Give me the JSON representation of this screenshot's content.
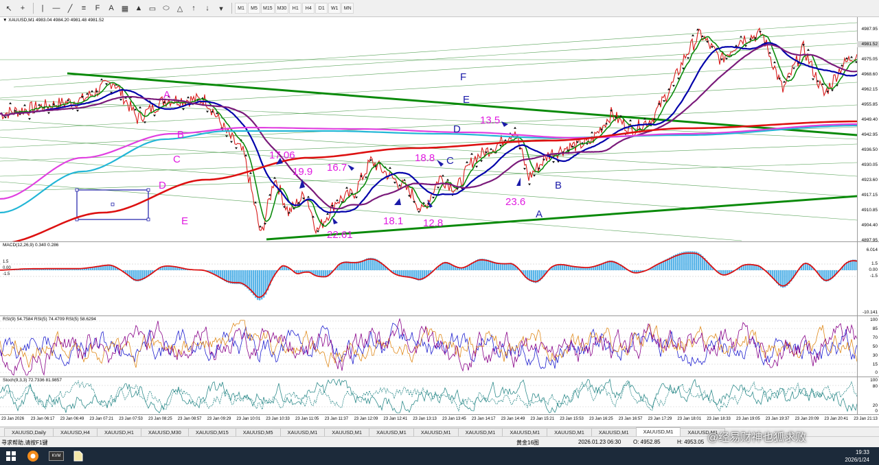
{
  "toolbar": {
    "timeframes": [
      "M1",
      "M5",
      "M15",
      "M30",
      "H1",
      "H4",
      "D1",
      "W1",
      "MN"
    ]
  },
  "main_pane": {
    "title": "XAUUSD,M1  4983.04 4984.20 4981.48 4981.52",
    "price_tag": "4981.52",
    "price_labels": [
      "4987.95",
      "4981.52",
      "4975.05",
      "4968.60",
      "4962.15",
      "4955.85",
      "4949.40",
      "4942.95",
      "4936.50",
      "4930.05",
      "4923.60",
      "4917.15",
      "4910.85",
      "4904.40",
      "4897.95"
    ],
    "wave_labels_magenta": [
      "A",
      "B",
      "C",
      "D",
      "E"
    ],
    "wave_labels_blue": [
      "F",
      "E",
      "D",
      "C",
      "B",
      "A"
    ],
    "number_labels": [
      "17.06",
      "19.9",
      "16.7",
      "18.8",
      "13.5",
      "22.61",
      "18.1",
      "12.8",
      "23.6"
    ]
  },
  "macd_pane": {
    "title": "MACD(12,26,9) 0.340 0.286",
    "axis_labels": [
      "6.014",
      "1.5",
      "0.00",
      "-1.5",
      "-10.141"
    ],
    "left_labels": [
      "1.5",
      "0.00",
      "-1.5"
    ]
  },
  "rsi_pane": {
    "title": "RSI(9) 54.7584  RSI(5) 74.4709  RSI(5) 58.6294",
    "axis_labels": [
      "100",
      "85",
      "70",
      "50",
      "30",
      "15",
      "0"
    ]
  },
  "stoch_pane": {
    "title": "Stoch(9,3,3) 72.7336 81.9857",
    "axis_labels": [
      "100",
      "80",
      "20",
      "0"
    ]
  },
  "time_axis": [
    "23 Jan 2026",
    "23 Jan 06:17",
    "23 Jan 06:49",
    "23 Jan 07:21",
    "23 Jan 07:53",
    "23 Jan 08:25",
    "23 Jan 08:57",
    "23 Jan 09:29",
    "23 Jan 10:01",
    "23 Jan 10:33",
    "23 Jan 11:05",
    "23 Jan 11:37",
    "23 Jan 12:09",
    "23 Jan 12:41",
    "23 Jan 13:13",
    "23 Jan 13:45",
    "23 Jan 14:17",
    "23 Jan 14:49",
    "23 Jan 15:21",
    "23 Jan 15:53",
    "23 Jan 16:25",
    "23 Jan 16:57",
    "23 Jan 17:29",
    "23 Jan 18:01",
    "23 Jan 18:33",
    "23 Jan 19:05",
    "23 Jan 19:37",
    "23 Jan 20:09",
    "23 Jan 20:41",
    "23 Jan 21:13"
  ],
  "tabs": [
    "XAUUSD,Daily",
    "XAUUSD,H4",
    "XAUUSD,H1",
    "XAUUSD,M30",
    "XAUUSD,M15",
    "XAUUSD,M5",
    "XAUUSD,M1",
    "XAUUSD,M1",
    "XAUUSD,M1",
    "XAUUSD,M1",
    "XAUUSD,M1",
    "XAUUSD,M1",
    "XAUUSD,M1",
    "XAUUSD,M1",
    "XAUUSD,M1",
    "XAUUSD,M1"
  ],
  "active_tab_index": 14,
  "statusbar": {
    "help": "寻求帮助,请按F1键",
    "profile": "黄金16图",
    "datetime": "2026.01.23 06:30",
    "open": "O: 4952.85",
    "high": "H: 4953.05"
  },
  "watermark": "@经易财神也狐求败",
  "taskbar": {
    "app_label": "KVM",
    "time": "19:33",
    "date": "2026/1/24"
  },
  "colors": {
    "magenta": "#e01be0",
    "blue_label": "#1a1aa8",
    "ma_red": "#dd1111",
    "ma_blue": "#0000aa",
    "ma_purple": "#7a1a7a",
    "ma_cyan": "#22b6d6",
    "ma_pink": "#e040e0",
    "ma_green": "#008800"
  }
}
